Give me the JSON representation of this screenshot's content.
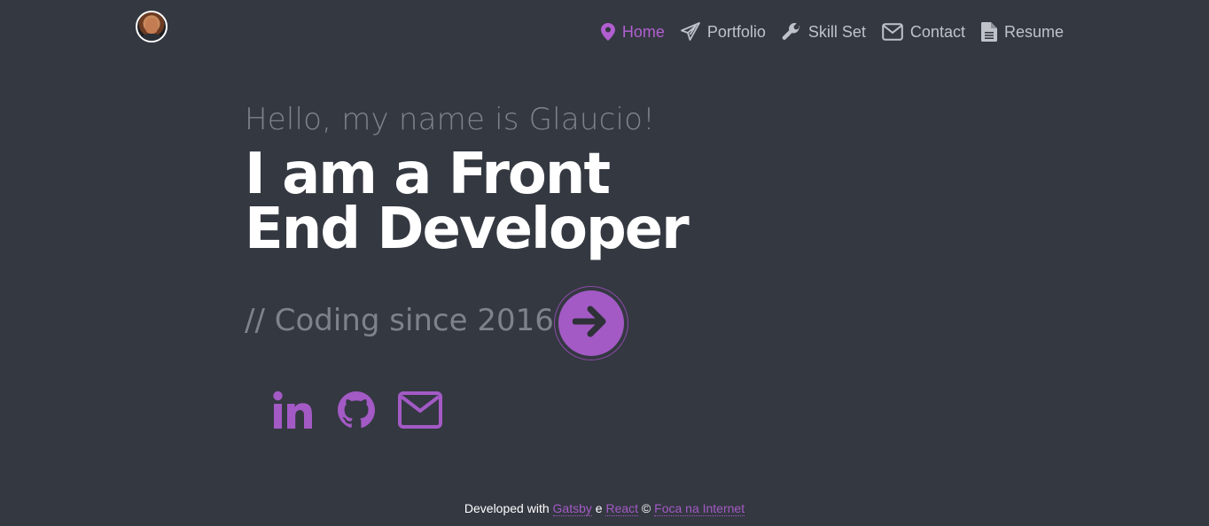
{
  "header": {
    "nav": [
      {
        "label": "Home",
        "icon": "map-marker-icon",
        "active": true
      },
      {
        "label": "Portfolio",
        "icon": "paper-plane-icon",
        "active": false
      },
      {
        "label": "Skill Set",
        "icon": "wrench-icon",
        "active": false
      },
      {
        "label": "Contact",
        "icon": "envelope-icon",
        "active": false
      },
      {
        "label": "Resume",
        "icon": "document-icon",
        "active": false
      }
    ]
  },
  "hero": {
    "greeting": "Hello, my name is Glaucio!",
    "headline_line1": "I am a Front",
    "headline_line2": "End Developer",
    "coding_since": "// Coding since 2016"
  },
  "socials": [
    {
      "icon": "linkedin-icon"
    },
    {
      "icon": "github-icon"
    },
    {
      "icon": "envelope-icon"
    }
  ],
  "footer": {
    "prefix": "Developed with",
    "link1": "Gatsby",
    "sep1": "e",
    "link2": "React",
    "sep2": "©",
    "link3": "Foca na Internet"
  },
  "colors": {
    "background": "#343841",
    "accent": "#a35ac5",
    "nav_text": "#bfc3c9",
    "muted_text": "#7e838b"
  }
}
